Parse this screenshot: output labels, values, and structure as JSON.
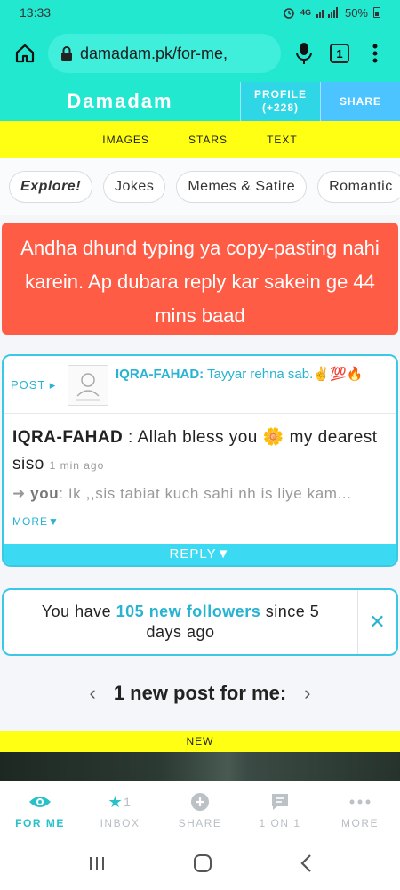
{
  "status_bar": {
    "time": "13:33",
    "network": "4G",
    "battery": "50%"
  },
  "browser": {
    "url": "damadam.pk/for-me,",
    "tab_count": "1"
  },
  "header": {
    "brand": "Damadam",
    "profile_label": "PROFILE",
    "profile_count": "(+228)",
    "share_label": "SHARE"
  },
  "sub_nav": {
    "items": [
      "IMAGES",
      "STARS",
      "TEXT"
    ]
  },
  "chips": [
    "Explore!",
    "Jokes",
    "Memes & Satire",
    "Romantic"
  ],
  "alert": {
    "text": "Andha dhund typing ya copy-pasting nahi karein. Ap dubara reply kar sakein ge 44 mins baad"
  },
  "post": {
    "label": "POST ▸",
    "author": "IQRA-FAHAD:",
    "title": " Tayyar rehna sab.✌️💯🔥",
    "reply_author": "IQRA-FAHAD",
    "reply_text": " : Allah bless you 🌼 my dearest siso ",
    "reply_time": "1 min ago",
    "you_label": "you",
    "you_text": ": Ik ,,sis tabiat kuch sahi nh is liye kam... ",
    "more_label": "MORE▼",
    "reply_button": "REPLY▼"
  },
  "followers": {
    "prefix": "You have ",
    "highlight": "105 new followers",
    "suffix": " since 5 days ago",
    "close": "✕"
  },
  "newpost": {
    "label": "1 new post for me:",
    "prev": "‹",
    "next": "›"
  },
  "new_badge": "NEW",
  "bottom_tabs": [
    {
      "label": "FOR ME",
      "icon": "eye-icon",
      "active": true
    },
    {
      "label": "INBOX",
      "icon": "star-icon",
      "badge": "1"
    },
    {
      "label": "SHARE",
      "icon": "plus-circle-icon"
    },
    {
      "label": "1 ON 1",
      "icon": "chat-icon"
    },
    {
      "label": "MORE",
      "icon": "dots-icon"
    }
  ],
  "colors": {
    "accent": "#23e8d0",
    "yellow": "#ffff13",
    "alert": "#ff5c46",
    "link": "#27b3d1"
  }
}
